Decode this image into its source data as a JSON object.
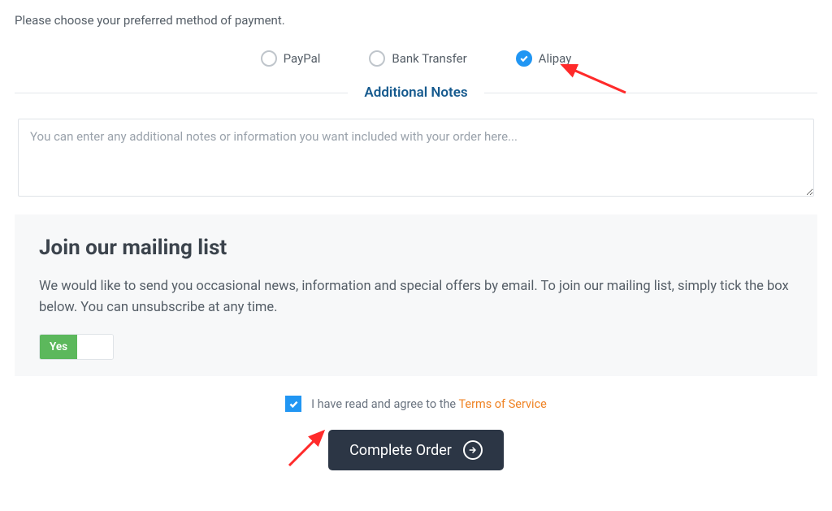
{
  "payment": {
    "prompt": "Please choose your preferred method of payment.",
    "options": {
      "paypal": {
        "label": "PayPal",
        "checked": false
      },
      "bank": {
        "label": "Bank Transfer",
        "checked": false
      },
      "alipay": {
        "label": "Alipay",
        "checked": true
      }
    }
  },
  "notes": {
    "section_title": "Additional Notes",
    "placeholder": "You can enter any additional notes or information you want included with your order here..."
  },
  "mailing": {
    "title": "Join our mailing list",
    "description": "We would like to send you occasional news, information and special offers by email. To join our mailing list, simply tick the box below. You can unsubscribe at any time.",
    "toggle_on_label": "Yes",
    "toggle_state": "on"
  },
  "tos": {
    "checked": true,
    "text": "I have read and agree to the ",
    "link_text": "Terms of Service"
  },
  "submit": {
    "label": "Complete Order"
  }
}
